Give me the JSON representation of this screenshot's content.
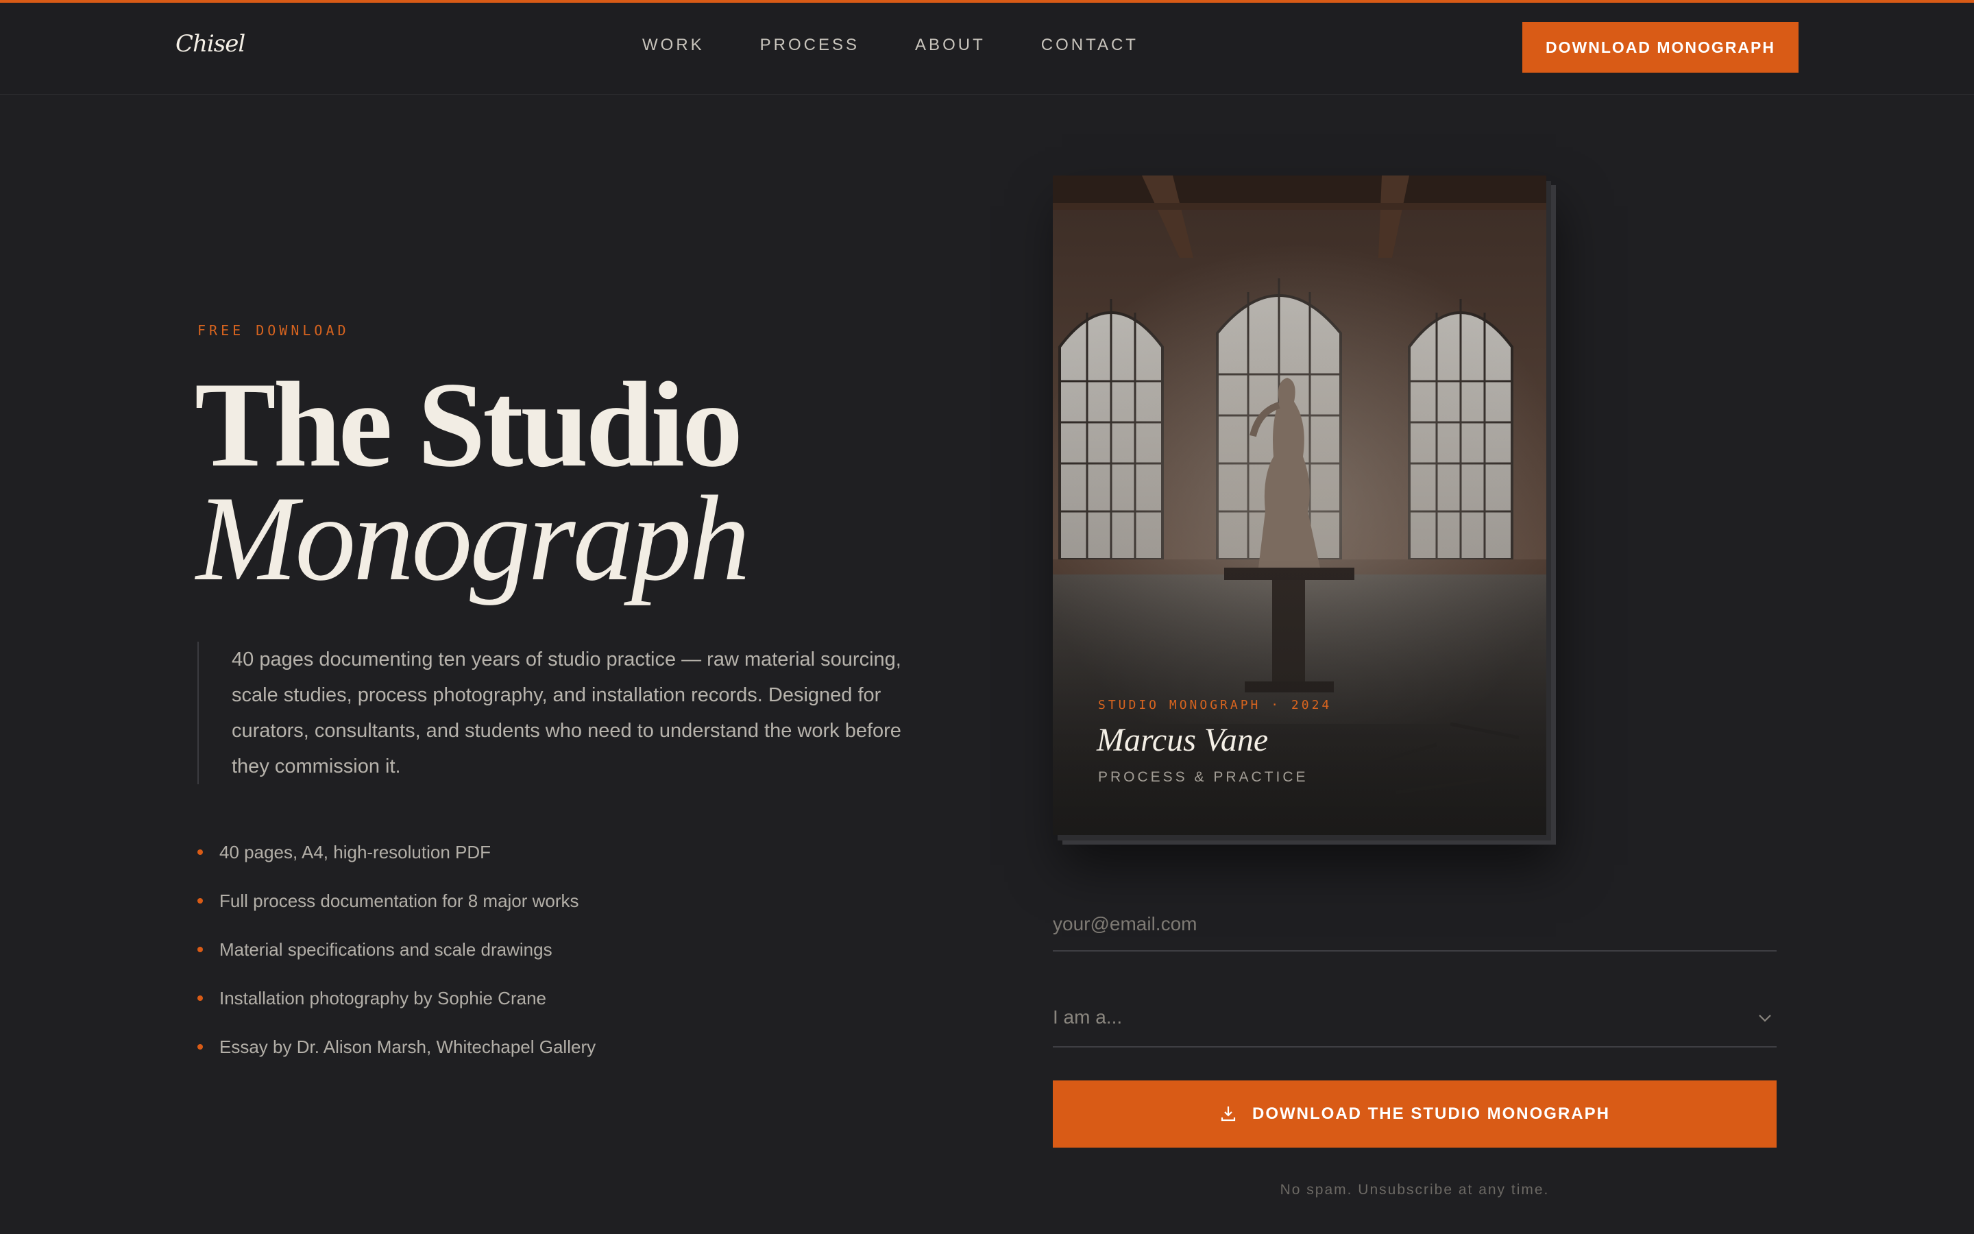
{
  "colors": {
    "accent": "#d95b16",
    "background": "#1f1f22",
    "text": "#f2ede4",
    "muted": "#b7b3ac"
  },
  "nav": {
    "logo": "Chisel",
    "links": [
      {
        "label": "WORK"
      },
      {
        "label": "PROCESS"
      },
      {
        "label": "ABOUT"
      },
      {
        "label": "CONTACT"
      }
    ],
    "cta_label": "DOWNLOAD MONOGRAPH"
  },
  "hero": {
    "eyebrow": "FREE DOWNLOAD",
    "title_line1": "The Studio",
    "title_line2": "Monograph",
    "description": "40 pages documenting ten years of studio practice — raw material sourcing, scale studies, process photography, and installation records. Designed for curators, consultants, and students who need to understand the work before they commission it.",
    "features": [
      "40 pages, A4, high-resolution PDF",
      "Full process documentation for 8 major works",
      "Material specifications and scale drawings",
      "Installation photography by Sophie Crane",
      "Essay by Dr. Alison Marsh, Whitechapel Gallery"
    ]
  },
  "book": {
    "meta": "STUDIO MONOGRAPH · 2024",
    "author": "Marcus Vane",
    "subtitle": "PROCESS & PRACTICE"
  },
  "form": {
    "email_placeholder": "your@email.com",
    "role_selected": "I am a...",
    "submit_label": "DOWNLOAD THE STUDIO MONOGRAPH",
    "submit_icon": "download-icon",
    "fineprint": "No spam. Unsubscribe at any time."
  }
}
